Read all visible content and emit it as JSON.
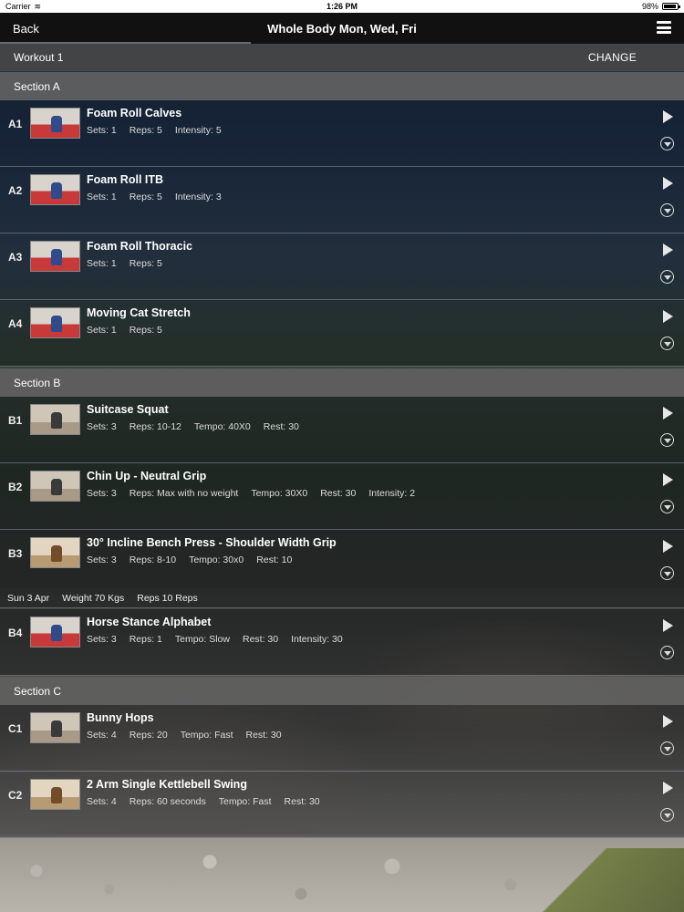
{
  "status": {
    "carrier": "Carrier",
    "time": "1:26 PM",
    "battery": "98%"
  },
  "nav": {
    "back_label": "Back",
    "title": "Whole Body Mon, Wed, Fri"
  },
  "workout": {
    "name": "Workout 1",
    "change_label": "CHANGE"
  },
  "sections": [
    {
      "title": "Section A",
      "exercises": [
        {
          "code": "A1",
          "name": "Foam Roll Calves",
          "meta": [
            "Sets: 1",
            "Reps: 5",
            "Intensity: 5"
          ]
        },
        {
          "code": "A2",
          "name": "Foam Roll ITB",
          "meta": [
            "Sets: 1",
            "Reps: 5",
            "Intensity: 3"
          ]
        },
        {
          "code": "A3",
          "name": "Foam Roll Thoracic",
          "meta": [
            "Sets: 1",
            "Reps: 5"
          ]
        },
        {
          "code": "A4",
          "name": "Moving Cat Stretch",
          "meta": [
            "Sets: 1",
            "Reps: 5"
          ]
        }
      ]
    },
    {
      "title": "Section B",
      "exercises": [
        {
          "code": "B1",
          "name": "Suitcase Squat",
          "meta": [
            "Sets: 3",
            "Reps: 10-12",
            "Tempo: 40X0",
            "Rest: 30"
          ]
        },
        {
          "code": "B2",
          "name": "Chin Up - Neutral Grip",
          "meta": [
            "Sets: 3",
            "Reps: Max with no weight",
            "Tempo: 30X0",
            "Rest: 30",
            "Intensity: 2"
          ]
        },
        {
          "code": "B3",
          "name": "30° Incline Bench Press - Shoulder Width Grip",
          "meta": [
            "Sets: 3",
            "Reps: 8-10",
            "Tempo: 30x0",
            "Rest: 10"
          ]
        },
        {
          "code": "B4",
          "name": "Horse Stance Alphabet",
          "meta": [
            "Sets: 3",
            "Reps: 1",
            "Tempo: Slow",
            "Rest: 30",
            "Intensity: 30"
          ]
        }
      ]
    },
    {
      "title": "Section C",
      "exercises": [
        {
          "code": "C1",
          "name": "Bunny Hops",
          "meta": [
            "Sets: 4",
            "Reps: 20",
            "Tempo: Fast",
            "Rest: 30"
          ]
        },
        {
          "code": "C2",
          "name": "2 Arm Single Kettlebell Swing",
          "meta": [
            "Sets: 4",
            "Reps: 60 seconds",
            "Tempo: Fast",
            "Rest: 30"
          ]
        }
      ]
    }
  ],
  "log_entry": {
    "date": "Sun 3 Apr",
    "weight": "Weight 70 Kgs",
    "reps": "Reps 10 Reps"
  }
}
